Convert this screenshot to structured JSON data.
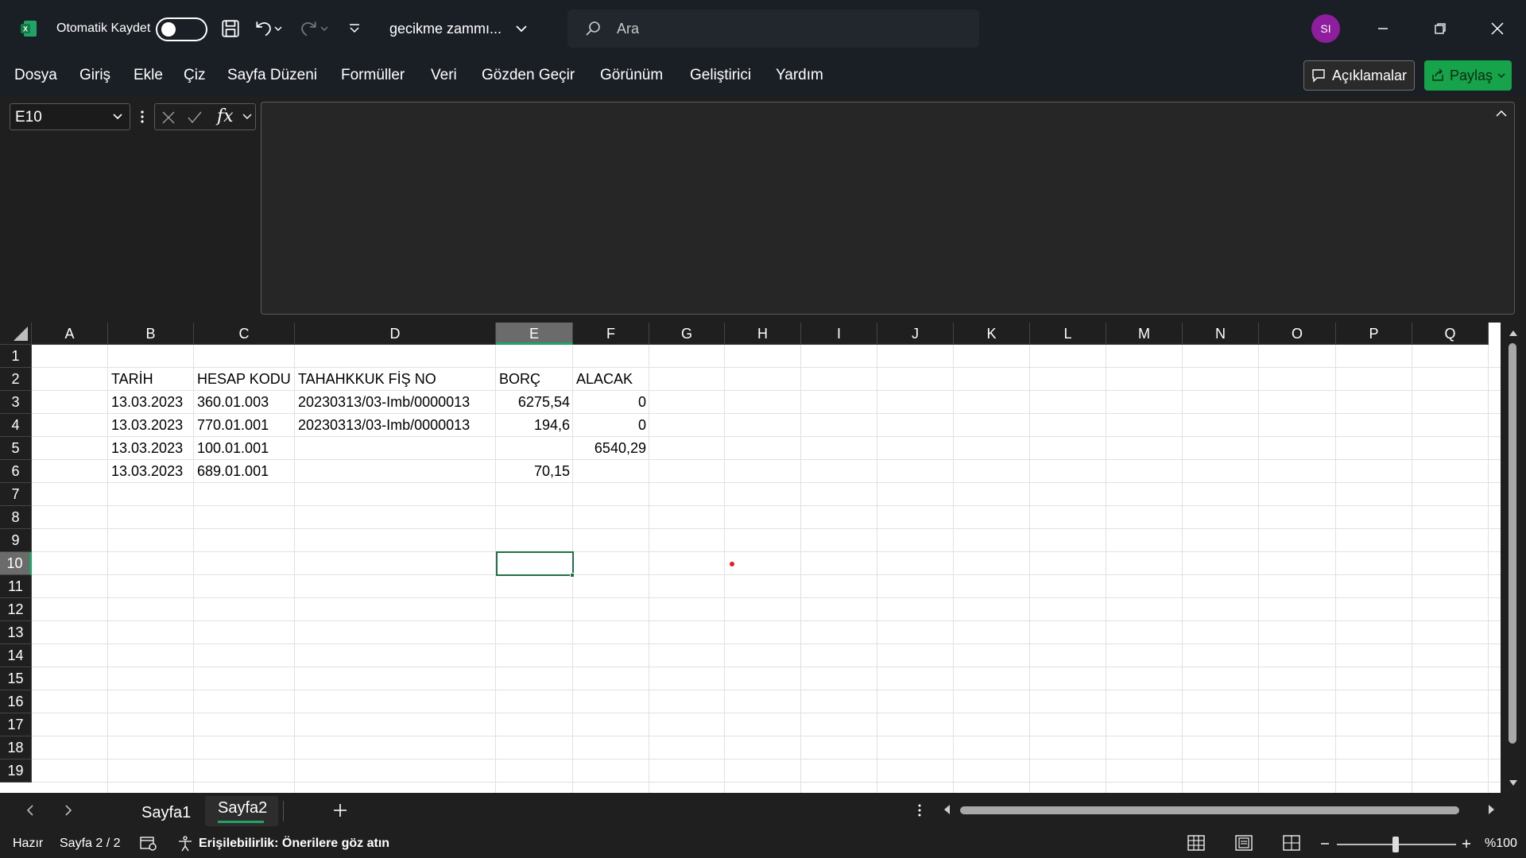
{
  "app": {
    "autosave_label": "Otomatik Kaydet",
    "doc_title": "gecikme zammı...",
    "search_placeholder": "Ara",
    "avatar_initials": "SI",
    "accent": "#21a366",
    "share_color": "#16a34a"
  },
  "menu": [
    "Dosya",
    "Giriş",
    "Ekle",
    "Çiz",
    "Sayfa Düzeni",
    "Formüller",
    "Veri",
    "Gözden Geçir",
    "Görünüm",
    "Geliştirici",
    "Yardım"
  ],
  "ribbon_buttons": {
    "comments": "Açıklamalar",
    "share": "Paylaş"
  },
  "formula_bar": {
    "name_box": "E10",
    "formula": ""
  },
  "columns": [
    "A",
    "B",
    "C",
    "D",
    "E",
    "F",
    "G",
    "H",
    "I",
    "J",
    "K",
    "L",
    "M",
    "N",
    "O",
    "P",
    "Q"
  ],
  "rows": [
    "1",
    "2",
    "3",
    "4",
    "5",
    "6",
    "7",
    "8",
    "9",
    "10",
    "11",
    "12",
    "13",
    "14",
    "15",
    "16",
    "17",
    "18",
    "19"
  ],
  "cells": {
    "headers": [
      "TARİH",
      "HESAP KODU",
      "TAHAHKKUK FİŞ NO",
      "BORÇ",
      "ALACAK"
    ],
    "data": [
      [
        "13.03.2023",
        "360.01.003",
        "20230313/03-Imb/0000013",
        "6275,54",
        "0"
      ],
      [
        "13.03.2023",
        "770.01.001",
        "20230313/03-Imb/0000013",
        "194,6",
        "0"
      ],
      [
        "13.03.2023",
        "100.01.001",
        "",
        "",
        "6540,29"
      ],
      [
        "13.03.2023",
        "689.01.001",
        "",
        "70,15",
        ""
      ]
    ]
  },
  "sheets": {
    "tab1": "Sayfa1",
    "tab2": "Sayfa2",
    "active": "Sayfa2"
  },
  "status": {
    "ready": "Hazır",
    "page": "Sayfa 2 / 2",
    "accessibility": "Erişilebilirlik: Önerilere göz atın",
    "zoom": "%100"
  }
}
